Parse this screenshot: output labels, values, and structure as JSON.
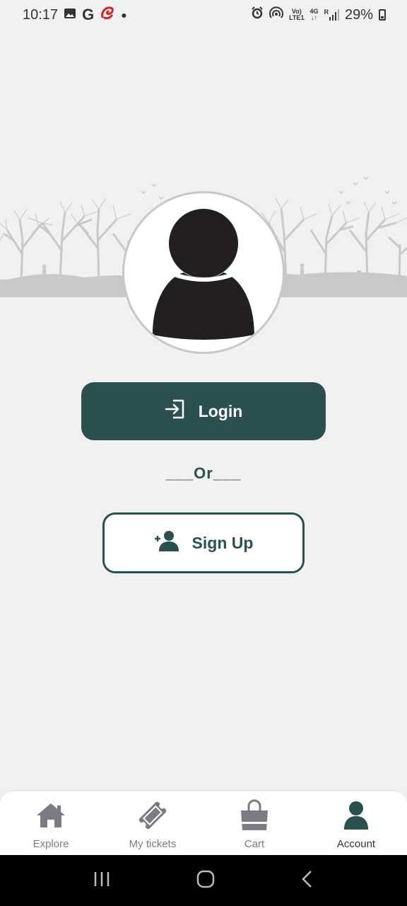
{
  "status": {
    "time": "10:17",
    "battery": "29%",
    "volte_top": "Vo)",
    "volte_bottom": "LTE1",
    "network": "4G",
    "roaming": "R"
  },
  "buttons": {
    "login_label": "Login",
    "or_label": "___Or___",
    "signup_label": "Sign Up"
  },
  "nav": {
    "items": [
      {
        "label": "Explore",
        "icon": "home-icon"
      },
      {
        "label": "My tickets",
        "icon": "ticket-icon"
      },
      {
        "label": "Cart",
        "icon": "shopping-bag-icon"
      },
      {
        "label": "Account",
        "icon": "user-icon",
        "active": true
      }
    ]
  },
  "colors": {
    "primary": "#2b5050",
    "nav_inactive": "#7b7b86",
    "background": "#f1f1f1"
  }
}
